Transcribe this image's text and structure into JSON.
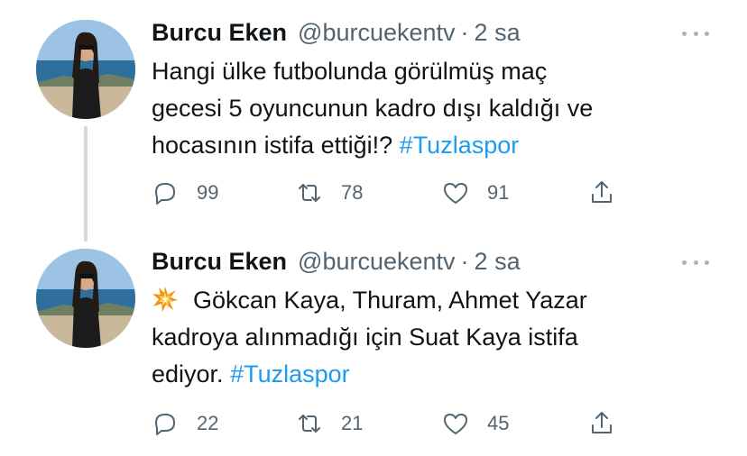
{
  "tweets": [
    {
      "author": {
        "name": "Burcu Eken",
        "handle": "@burcuekentv"
      },
      "separator": "·",
      "time": "2 sa",
      "text": {
        "line1": "Hangi ülke futbolunda görülmüş maç",
        "line2": "gecesi 5 oyuncunun kadro dışı kaldığı ve",
        "line3": "hocasının istifa ettiği!?",
        "hashtag": "#Tuzlaspor"
      },
      "stats": {
        "replies": "99",
        "retweets": "78",
        "likes": "91"
      }
    },
    {
      "author": {
        "name": "Burcu Eken",
        "handle": "@burcuekentv"
      },
      "separator": "·",
      "time": "2 sa",
      "text": {
        "emoji": "collision-emoji",
        "line1": "Gökcan Kaya, Thuram, Ahmet Yazar",
        "line2": "kadroya alınmadığı için Suat Kaya istifa",
        "line3": "ediyor.",
        "hashtag": "#Tuzlaspor"
      },
      "stats": {
        "replies": "22",
        "retweets": "21",
        "likes": "45"
      }
    }
  ],
  "colors": {
    "link": "#1d9bf0",
    "secondary": "#536471",
    "thread_line": "#cfd9de"
  },
  "icons": [
    "reply-icon",
    "retweet-icon",
    "like-icon",
    "share-icon",
    "more-icon"
  ]
}
